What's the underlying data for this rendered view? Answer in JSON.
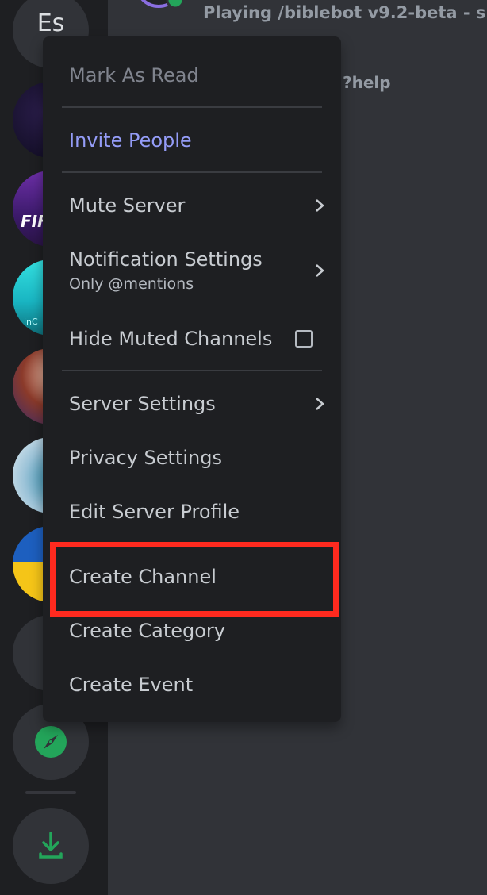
{
  "server_rail": {
    "current_server_initials": "Es",
    "servers": [
      {
        "name": "dark-nebula-server"
      },
      {
        "name": "fifa-server",
        "visible_text": "FIF"
      },
      {
        "name": "ocean-server",
        "visible_text": "inC"
      },
      {
        "name": "anime-server"
      },
      {
        "name": "ice-server"
      },
      {
        "name": "blue-yellow-server"
      }
    ],
    "add_server_label": "+",
    "explore_icon": "compass-icon",
    "download_icon": "download-icon"
  },
  "activity": {
    "status": "online",
    "text": "Playing /biblebot v9.2-beta - s..."
  },
  "channel_preview": {
    "help_text": "?help"
  },
  "context_menu": {
    "mark_as_read": "Mark As Read",
    "invite_people": "Invite People",
    "mute_server": "Mute Server",
    "notification_settings": "Notification Settings",
    "notification_value": "Only @mentions",
    "hide_muted_channels": "Hide Muted Channels",
    "hide_muted_checked": false,
    "server_settings": "Server Settings",
    "privacy_settings": "Privacy Settings",
    "edit_server_profile": "Edit Server Profile",
    "create_channel": "Create Channel",
    "create_category": "Create Category",
    "create_event": "Create Event"
  },
  "colors": {
    "accent_invite": "#949cf7",
    "highlight_box": "#ff2a1f",
    "green": "#23a55a"
  }
}
